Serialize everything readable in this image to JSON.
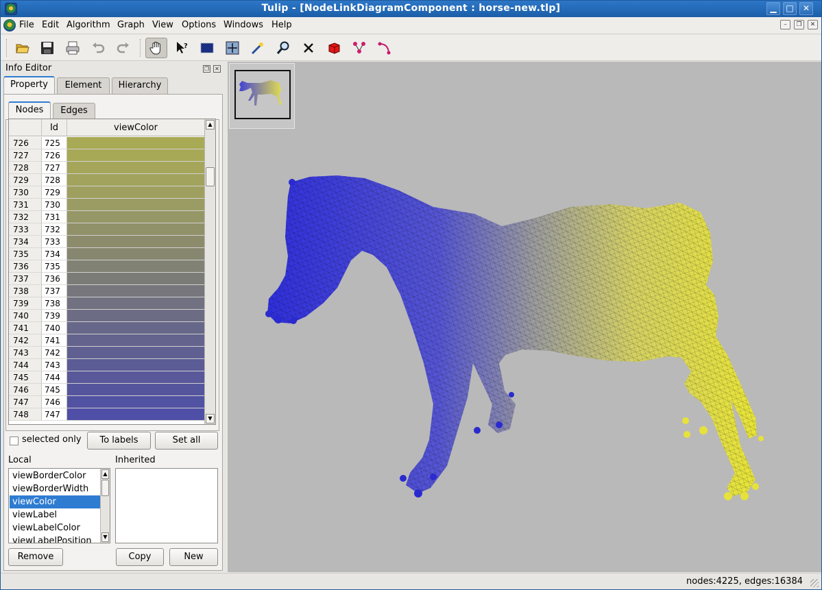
{
  "window": {
    "title": "Tulip - [NodeLinkDiagramComponent : horse-new.tlp]"
  },
  "menu": [
    "File",
    "Edit",
    "Algorithm",
    "Graph",
    "View",
    "Options",
    "Windows",
    "Help"
  ],
  "toolbar": [
    "open-icon",
    "save-icon",
    "print-icon",
    "undo-icon",
    "redo-icon",
    "hand-icon",
    "whats-this-icon",
    "select-rect-icon",
    "select-box-icon",
    "magic-wand-icon",
    "zoom-icon",
    "delete-icon",
    "cube-icon",
    "add-node-icon",
    "add-edge-icon"
  ],
  "dock": {
    "title": "Info Editor",
    "tabs": [
      "Property",
      "Element",
      "Hierarchy"
    ],
    "subtabs": [
      "Nodes",
      "Edges"
    ],
    "table": {
      "headers": [
        "",
        "Id",
        "viewColor"
      ],
      "rows": [
        {
          "row": "726",
          "id": "725",
          "color": "#a9aa55"
        },
        {
          "row": "727",
          "id": "726",
          "color": "#a8a957"
        },
        {
          "row": "728",
          "id": "727",
          "color": "#a5a65a"
        },
        {
          "row": "729",
          "id": "728",
          "color": "#a2a35c"
        },
        {
          "row": "730",
          "id": "729",
          "color": "#9fa05f"
        },
        {
          "row": "731",
          "id": "730",
          "color": "#9b9c63"
        },
        {
          "row": "732",
          "id": "731",
          "color": "#969767"
        },
        {
          "row": "733",
          "id": "732",
          "color": "#919169"
        },
        {
          "row": "734",
          "id": "733",
          "color": "#8c8c6c"
        },
        {
          "row": "735",
          "id": "734",
          "color": "#878770"
        },
        {
          "row": "736",
          "id": "735",
          "color": "#818174"
        },
        {
          "row": "737",
          "id": "736",
          "color": "#7b7b78"
        },
        {
          "row": "738",
          "id": "737",
          "color": "#76767c"
        },
        {
          "row": "739",
          "id": "738",
          "color": "#717181"
        },
        {
          "row": "740",
          "id": "739",
          "color": "#6c6c85"
        },
        {
          "row": "741",
          "id": "740",
          "color": "#676789"
        },
        {
          "row": "742",
          "id": "741",
          "color": "#63638d"
        },
        {
          "row": "743",
          "id": "742",
          "color": "#5f5f91"
        },
        {
          "row": "744",
          "id": "743",
          "color": "#5b5b96"
        },
        {
          "row": "745",
          "id": "744",
          "color": "#58589a"
        },
        {
          "row": "746",
          "id": "745",
          "color": "#55559e"
        },
        {
          "row": "747",
          "id": "746",
          "color": "#5252a3"
        },
        {
          "row": "748",
          "id": "747",
          "color": "#4f4fa7"
        }
      ]
    },
    "selected_only_label": "selected only",
    "to_labels": "To labels",
    "set_all": "Set all",
    "local_label": "Local",
    "inherited_label": "Inherited",
    "local_items": [
      "viewBorderColor",
      "viewBorderWidth",
      "viewColor",
      "viewLabel",
      "viewLabelColor",
      "viewLabelPosition"
    ],
    "local_selected": "viewColor",
    "remove": "Remove",
    "copy": "Copy",
    "new": "New"
  },
  "status": "nodes:4225, edges:16384",
  "colors": {
    "accent": "#2e7cd2",
    "graph_blue": "#2222dd",
    "graph_yellow": "#e6e23a",
    "canvas": "#b9b9b9"
  }
}
